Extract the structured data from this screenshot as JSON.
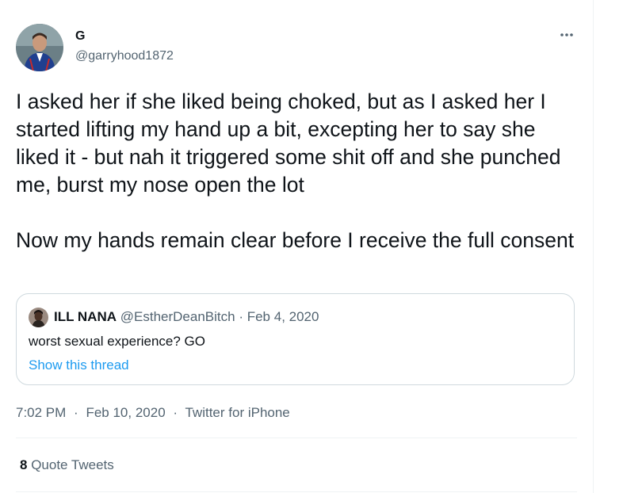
{
  "author": {
    "name": "G",
    "handle": "@garryhood1872",
    "avatar_icon": "profile-photo-icon"
  },
  "tweet": {
    "text": "I asked her if she liked being choked, but as I asked her I started lifting my hand up a bit, excepting her to say she liked it - but nah it triggered some shit off and she punched me, burst my nose open the lot\n\nNow my hands remain clear before I receive the full consent",
    "time": "7:02 PM",
    "date": "Feb 10, 2020",
    "source": "Twitter for iPhone",
    "separator": "·"
  },
  "quoted_tweet": {
    "name": "ILL NANA",
    "handle": "@EstherDeanBitch",
    "separator": "·",
    "date": "Feb 4, 2020",
    "text": "worst sexual experience? GO",
    "show_thread_label": "Show this thread"
  },
  "stats": {
    "quote_count": "8",
    "quote_label": "Quote Tweets"
  },
  "colors": {
    "text_primary": "#0f1419",
    "text_secondary": "#536471",
    "link": "#1d9bf0",
    "border": "#cfd9de",
    "divider": "#eff3f4"
  }
}
